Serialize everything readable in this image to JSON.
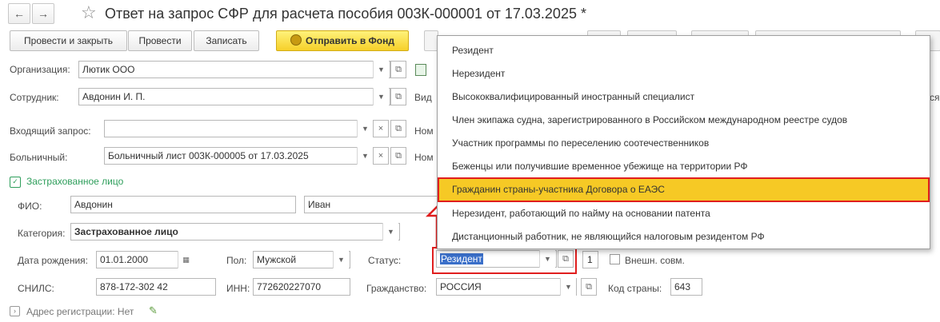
{
  "window": {
    "title": "Ответ на запрос СФР для расчета пособия 003К-000001 от 17.03.2025 *",
    "nav_back": "←",
    "nav_forward": "→",
    "star": "☆"
  },
  "toolbar": {
    "post_close_label": "Провести и закрыть",
    "post_label": "Провести",
    "write_label": "Записать",
    "send_fund_label": "Отправить в Фонд",
    "send_fund_icon": "coin-icon"
  },
  "form": {
    "org_label": "Организация:",
    "org_value": "Лютик ООО",
    "employee_label": "Сотрудник:",
    "employee_value": "Авдонин И. П.",
    "type_label_partial": "Вид",
    "incoming_label": "Входящий запрос:",
    "incoming_value": "",
    "num_label_partial_1": "Ном",
    "sick_label": "Больничный:",
    "sick_value": "Больничный лист 003К-000005 от 17.03.2025",
    "num_label_partial_2": "Ном",
    "right_edge_partial": "ся"
  },
  "insured": {
    "group_label": "Застрахованное лицо",
    "fio_label": "ФИО:",
    "last_name": "Авдонин",
    "first_name": "Иван",
    "category_label": "Категория:",
    "category_value": "Застрахованное лицо",
    "birth_label": "Дата рождения:",
    "birth_value": "01.01.2000",
    "sex_label": "Пол:",
    "sex_value": "Мужской",
    "status_label": "Статус:",
    "status_value": "Резидент",
    "status_count": "1",
    "external_label": "Внешн. совм.",
    "snils_label": "СНИЛС:",
    "snils_value": "878-172-302 42",
    "inn_label": "ИНН:",
    "inn_value": "772620227070",
    "citizenship_label": "Гражданство:",
    "citizenship_value": "РОССИЯ",
    "country_code_label": "Код страны:",
    "country_code_value": "643"
  },
  "address": {
    "label": "Адрес регистрации: Нет",
    "edit_icon": "pencil-icon"
  },
  "status_dropdown": {
    "items": [
      "Резидент",
      "Нерезидент",
      "Высококвалифицированный иностранный специалист",
      "Член экипажа судна, зарегистрированного в Российском международном реестре судов",
      "Участник программы по переселению соотечественников",
      "Беженцы или получившие временное убежище на территории РФ",
      "Гражданин страны-участника Договора о ЕАЭС",
      "Нерезидент, работающий по найму на основании патента",
      "Дистанционный работник, не являющийся налоговым резидентом РФ"
    ],
    "selected_index": 6
  },
  "colors": {
    "accent_yellow": "#f6c925",
    "highlight_red": "#e01e1e",
    "group_green": "#2e9e5b"
  }
}
